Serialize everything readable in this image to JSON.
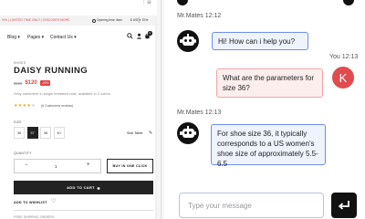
{
  "shop": {
    "topbar": {
      "promo": "%% | LIMITED TIME ONLY | DISCOVER MORE",
      "hours": "Opening time: 8am",
      "currency": "$ USD",
      "language": "EN"
    },
    "nav": {
      "items": [
        "Blog",
        "Pages",
        "Contact Us"
      ],
      "cart_count": "2"
    },
    "product": {
      "brand": "SHOES",
      "name": "DAISY RUNNING",
      "old_price": "$150",
      "new_price": "$120",
      "discount": "-20%",
      "description": "Grey cashmere in single breasted coat, available in 2 colors",
      "rating": 4,
      "reviews": "(6 Customers reviews)",
      "size_label": "SIZE",
      "sizes": [
        "36",
        "37",
        "38",
        "40"
      ],
      "selected_size": "37",
      "size_table": "Size Table",
      "quantity_label": "QUANTITY",
      "quantity": "1",
      "buy_now": "BUY IN ONE CLICK",
      "add_to_cart": "ADD TO CART",
      "wishlist": "ADD TO WISHLIST",
      "shipping": "FREE SHIPPING ORDERS"
    }
  },
  "chat": {
    "messages": [
      {
        "sender": "Mr.Mates",
        "time": "12:12",
        "text": "Hi! How can i help you?"
      },
      {
        "sender": "You",
        "time": "12:13",
        "text": "What are the parameters for size 36?",
        "avatar": "K"
      },
      {
        "sender": "Mr.Mates",
        "time": "12:13",
        "text": "For shoe size 36, it typically corresponds to a US women's shoe size of approximately 5.5-6.5"
      }
    ],
    "input_placeholder": "Type your message"
  },
  "colors": {
    "accent_red": "#e04b4f",
    "bot_bubble_border": "#6d8fe8",
    "user_bubble_border": "#f2a3a3"
  }
}
